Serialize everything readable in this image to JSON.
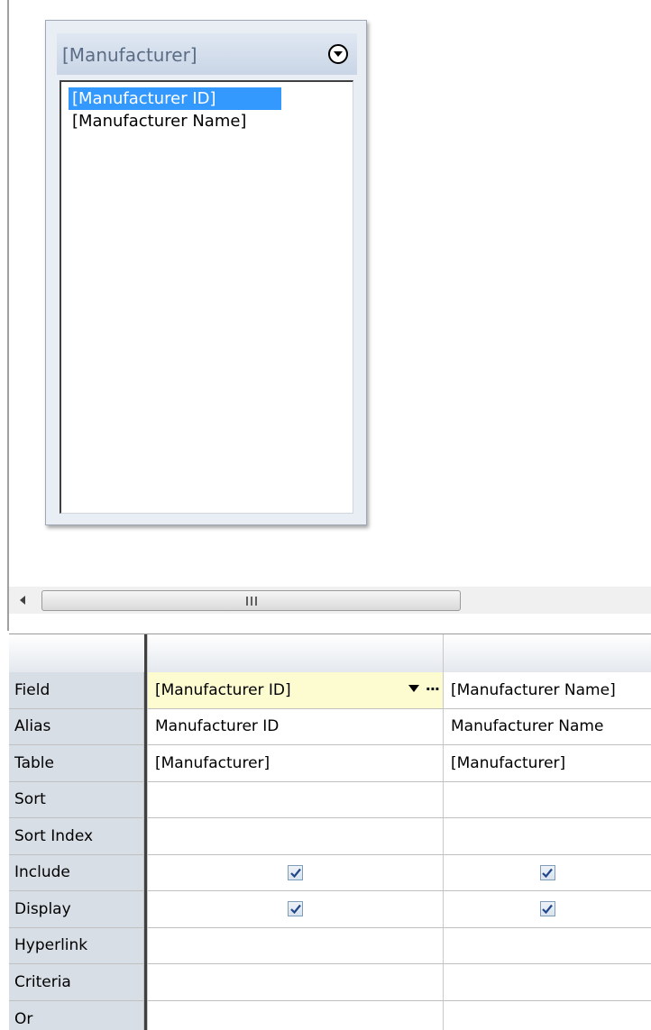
{
  "table_box": {
    "title": "[Manufacturer]",
    "fields": [
      "[Manufacturer ID]",
      "[Manufacturer Name]"
    ],
    "selected_index": 0
  },
  "scrollbar": {
    "grip_symbol": "III"
  },
  "grid": {
    "row_labels": [
      "Field",
      "Alias",
      "Table",
      "Sort",
      "Sort Index",
      "Include",
      "Display",
      "Hyperlink",
      "Criteria",
      "Or"
    ],
    "columns": [
      {
        "field": "[Manufacturer ID]",
        "alias": "Manufacturer ID",
        "table": "[Manufacturer]",
        "sort": "",
        "sort_index": "",
        "include": true,
        "display": true,
        "hyperlink": "",
        "criteria": "",
        "or": ""
      },
      {
        "field": "[Manufacturer Name]",
        "alias": "Manufacturer Name",
        "table": "[Manufacturer]",
        "sort": "",
        "sort_index": "",
        "include": true,
        "display": true,
        "hyperlink": "",
        "criteria": "",
        "or": ""
      }
    ],
    "field_cell_ellipsis": "···"
  },
  "colors": {
    "selection": "#3399ff",
    "field_edit_bg": "#fdfbd0",
    "row_label_bg": "#d8dee6"
  }
}
